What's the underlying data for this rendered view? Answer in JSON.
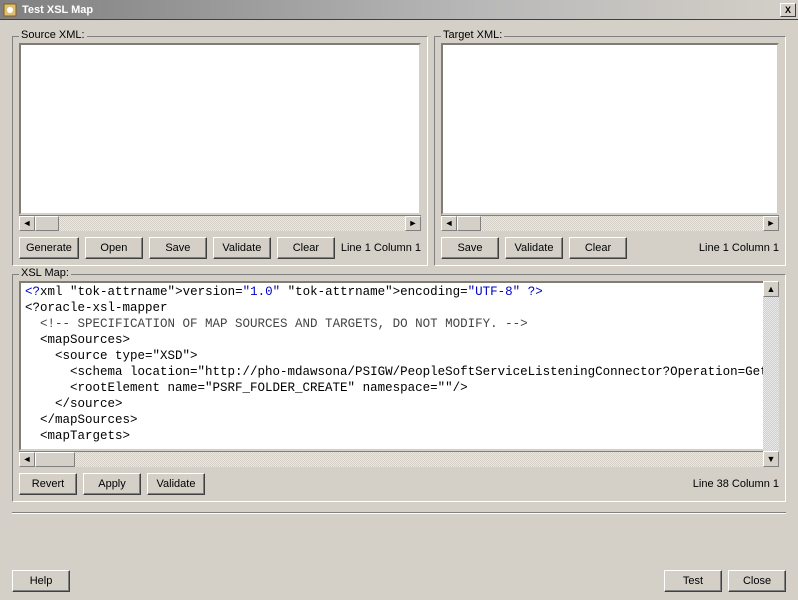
{
  "window": {
    "title": "Test XSL Map",
    "close_label": "X"
  },
  "source_xml": {
    "legend": "Source XML:",
    "content": "",
    "buttons": {
      "generate": "Generate",
      "open": "Open",
      "save": "Save",
      "validate": "Validate",
      "clear": "Clear"
    },
    "status": "Line 1 Column 1"
  },
  "target_xml": {
    "legend": "Target XML:",
    "content": "",
    "buttons": {
      "save": "Save",
      "validate": "Validate",
      "clear": "Clear"
    },
    "status": "Line 1 Column 1"
  },
  "xsl_map": {
    "legend": "XSL Map:",
    "code_lines": [
      {
        "type": "pi",
        "text": "<?xml version=\"1.0\" encoding=\"UTF-8\" ?>"
      },
      {
        "type": "tag",
        "text": "<?oracle-xsl-mapper"
      },
      {
        "type": "comment",
        "indent": 1,
        "text": "<!-- SPECIFICATION OF MAP SOURCES AND TARGETS, DO NOT MODIFY. -->"
      },
      {
        "type": "tag",
        "indent": 1,
        "text": "<mapSources>"
      },
      {
        "type": "tag",
        "indent": 2,
        "text": "<source type=\"XSD\">"
      },
      {
        "type": "tag",
        "indent": 3,
        "text": "<schema location=\"http://pho-mdawsona/PSIGW/PeopleSoftServiceListeningConnector?Operation=GetSchem"
      },
      {
        "type": "tag",
        "indent": 3,
        "text": "<rootElement name=\"PSRF_FOLDER_CREATE\" namespace=\"\"/>"
      },
      {
        "type": "tag",
        "indent": 2,
        "text": "</source>"
      },
      {
        "type": "tag",
        "indent": 1,
        "text": "</mapSources>"
      },
      {
        "type": "tag",
        "indent": 1,
        "text": "<mapTargets>"
      }
    ],
    "buttons": {
      "revert": "Revert",
      "apply": "Apply",
      "validate": "Validate"
    },
    "status": "Line 38 Column 1"
  },
  "footer": {
    "help": "Help",
    "test": "Test",
    "close": "Close"
  }
}
